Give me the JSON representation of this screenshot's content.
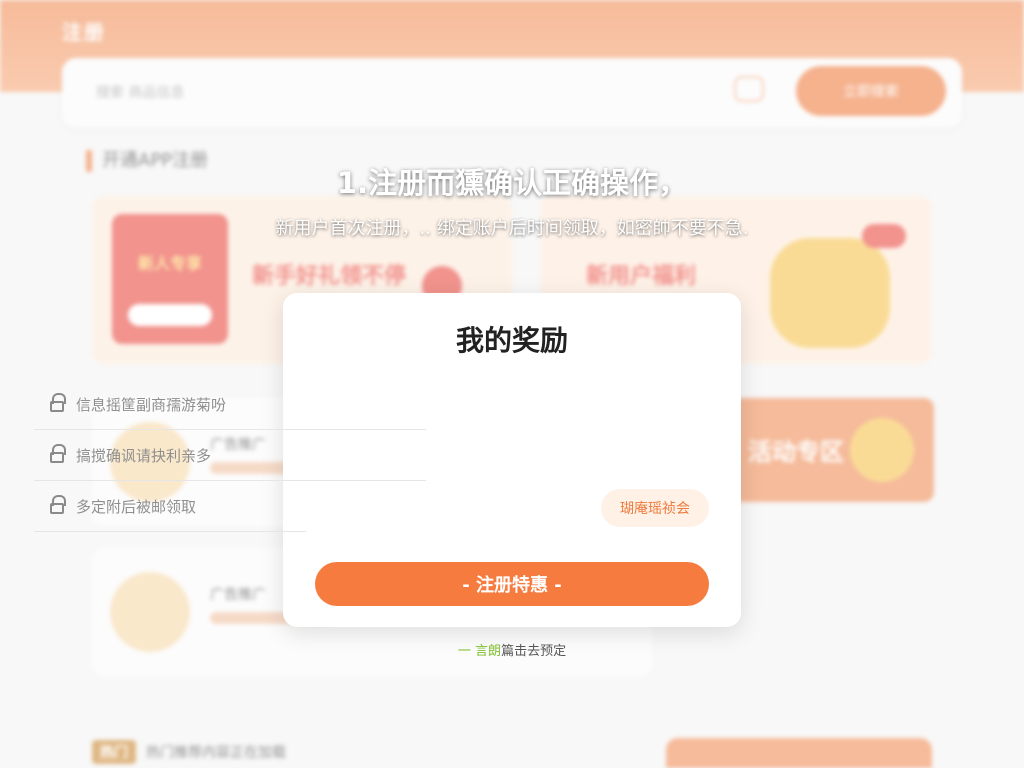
{
  "background": {
    "logo": "注册",
    "top_links": "",
    "search_placeholder": "搜索 商品信息",
    "search_button": "立即搜索",
    "section_title": "开通APP注册",
    "promo_left_badge": "新人专享",
    "promo_left_title": "新手好礼领不停",
    "promo_right_title": "新用户福利",
    "row1_title": "广告推广",
    "row2_title": "广告推广",
    "side_text": "活动专区",
    "bottom_badge": "热门",
    "bottom_text": "热门推荐内容正在加载"
  },
  "overlay": {
    "headline": "1.注册而獯确认正确操作，",
    "subline": "新用户首次注册，.. 绑定账户后时间领取，如密帥不要不急."
  },
  "dialog": {
    "title": "我的奖励",
    "field1_placeholder": "信息摇筐副商孺游菊吩",
    "field2_placeholder": "搞搅确讽请抉利亲多",
    "field3_placeholder": "多定附后被邮领取",
    "code_button": "瑚庵瑶祯会",
    "submit_button": "- 注册特惠 -"
  },
  "footnote": {
    "highlight": "一 言朗",
    "text": "篇击去预定"
  }
}
